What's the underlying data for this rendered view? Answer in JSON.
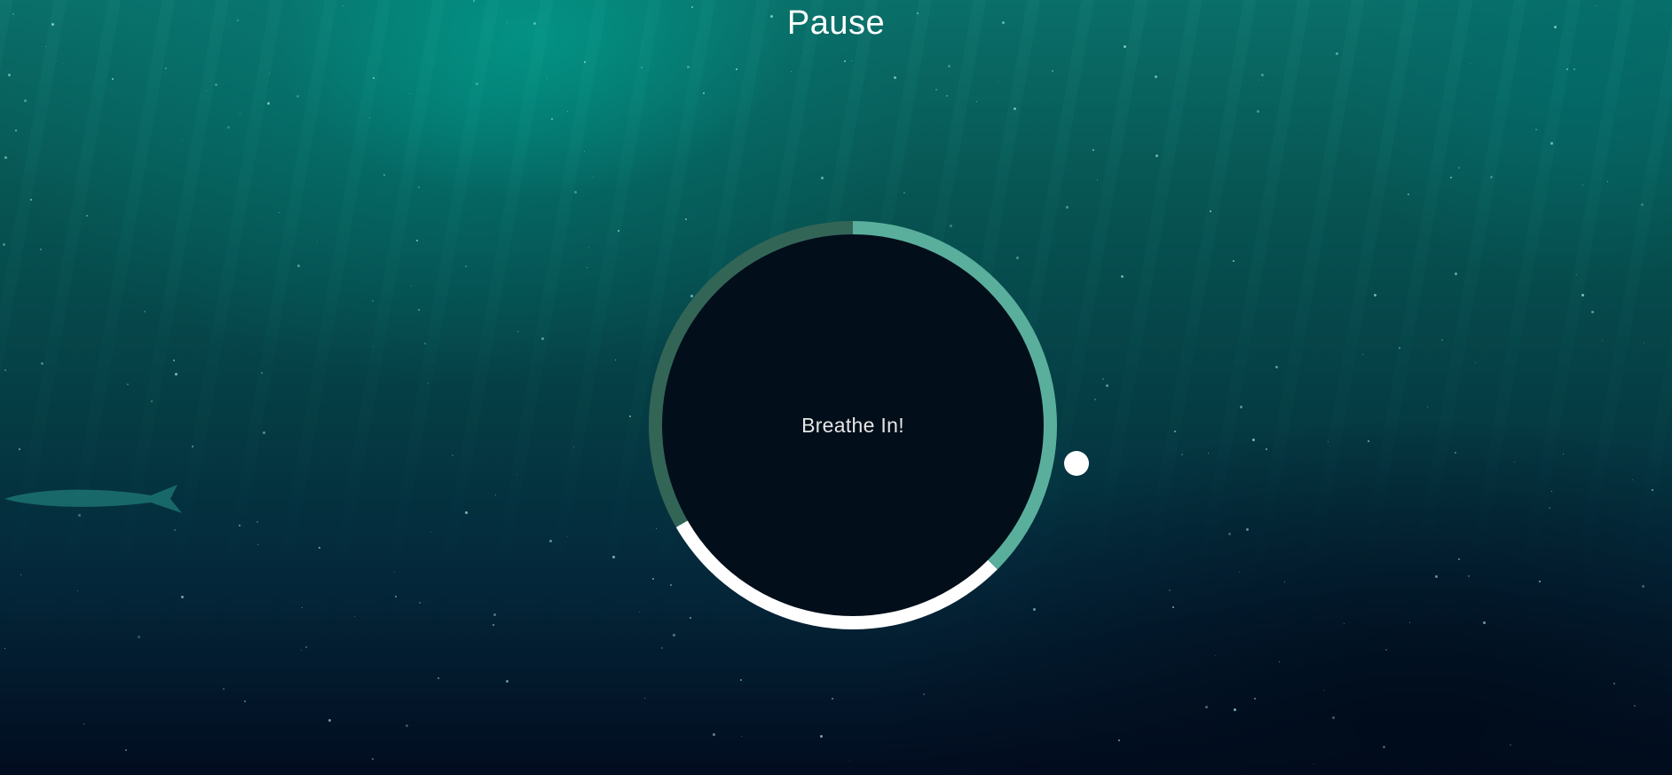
{
  "header": {
    "title": "Pause"
  },
  "breathing": {
    "instruction": "Breathe In!",
    "phases": [
      {
        "name": "breathe-in",
        "color": "#5aaf9c",
        "fraction": 0.375
      },
      {
        "name": "hold",
        "color": "#ffffff",
        "fraction": 0.29
      },
      {
        "name": "breathe-out",
        "color": "#336557",
        "fraction": 0.335
      }
    ]
  },
  "colors": {
    "background_top": "#0a6f69",
    "background_bottom": "#020c1f",
    "circle_fill": "#020e1a",
    "text": "#ffffff"
  }
}
